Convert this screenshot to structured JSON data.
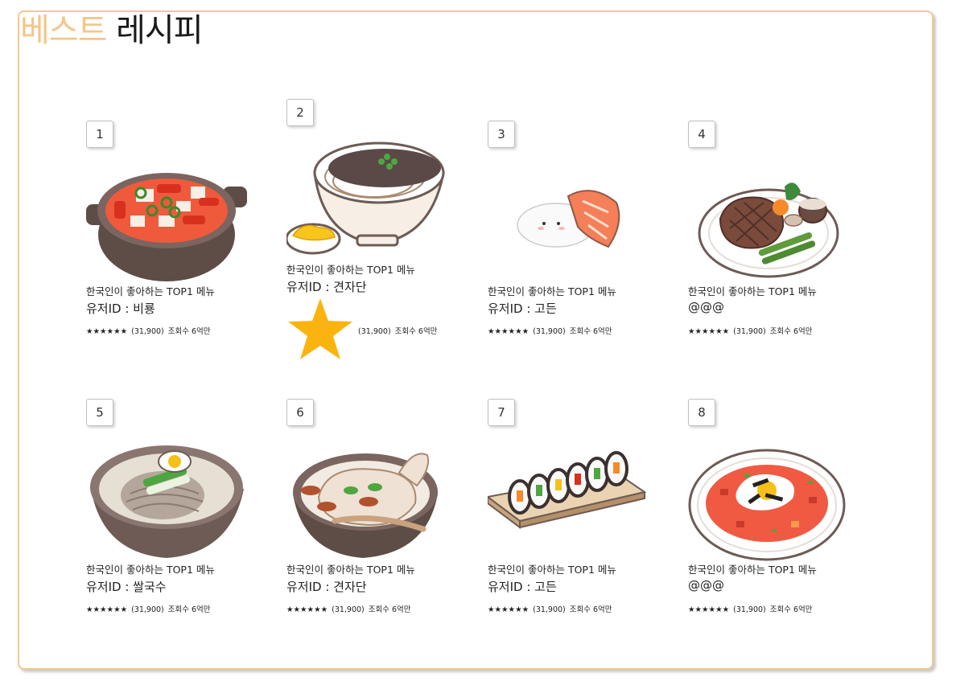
{
  "title": {
    "accent": "베스트",
    "rest": "레시피"
  },
  "cards": [
    {
      "rank": "1",
      "desc": "한국인이 좋아하는 TOP1 메뉴",
      "user": "유저ID : 비룡",
      "stars": "★★★★★★",
      "count": "(31,900)",
      "views": "조회수 6억만",
      "food": "kimchi-stew"
    },
    {
      "rank": "2",
      "desc": "한국인이 좋아하는 TOP1 메뉴",
      "user": "유저ID : 견자단",
      "stars": "",
      "count": "(31,900)",
      "views": "조회수 6억만",
      "food": "jajangmyeon"
    },
    {
      "rank": "3",
      "desc": "한국인이 좋아하는 TOP1 메뉴",
      "user": "유저ID : 고든",
      "stars": "★★★★★★",
      "count": "(31,900)",
      "views": "조회수 6억만",
      "food": "salmon-sushi"
    },
    {
      "rank": "4",
      "desc": "한국인이 좋아하는 TOP1 메뉴",
      "user": "@@@",
      "stars": "★★★★★★",
      "count": "(31,900)",
      "views": "조회수 6억만",
      "food": "steak"
    },
    {
      "rank": "5",
      "desc": "한국인이 좋아하는 TOP1 메뉴",
      "user": "유저ID : 쌀국수",
      "stars": "★★★★★★",
      "count": "(31,900)",
      "views": "조회수 6억만",
      "food": "naengmyeon"
    },
    {
      "rank": "6",
      "desc": "한국인이 좋아하는 TOP1 메뉴",
      "user": "유저ID : 견자단",
      "stars": "★★★★★★",
      "count": "(31,900)",
      "views": "조회수 6억만",
      "food": "samgyetang"
    },
    {
      "rank": "7",
      "desc": "한국인이 좋아하는 TOP1 메뉴",
      "user": "유저ID : 고든",
      "stars": "★★★★★★",
      "count": "(31,900)",
      "views": "조회수 6억만",
      "food": "kimbap"
    },
    {
      "rank": "8",
      "desc": "한국인이 좋아하는 TOP1 메뉴",
      "user": "@@@",
      "stars": "★★★★★★",
      "count": "(31,900)",
      "views": "조회수 6억만",
      "food": "kimchi-fried-rice"
    }
  ],
  "colors": {
    "accent": "#f4c58a",
    "border": "#f2c98d",
    "star": "#fbb40f"
  },
  "icons": {
    "highlighted_star": "star-icon"
  }
}
